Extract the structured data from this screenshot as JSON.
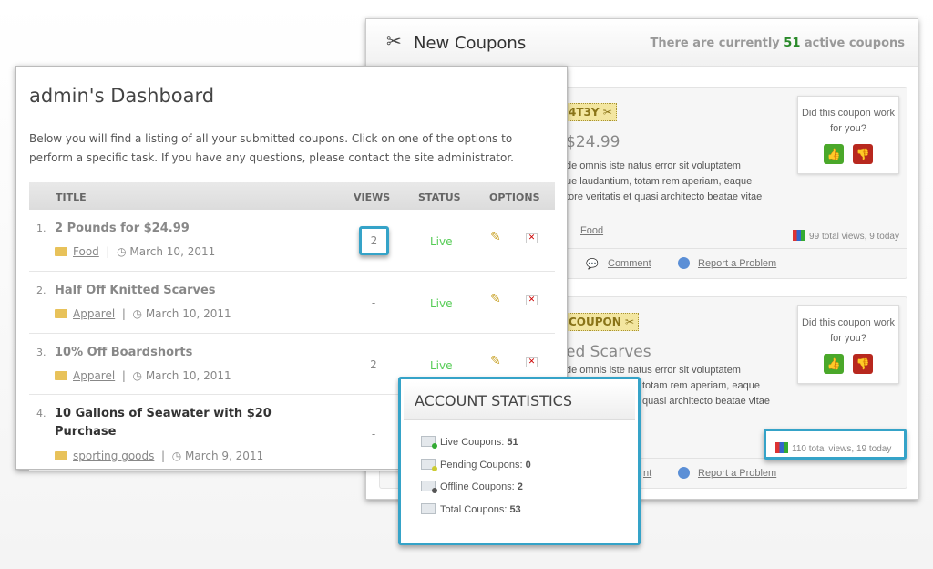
{
  "new_coupons": {
    "title": "New Coupons",
    "active_prefix": "There are currently ",
    "active_count": "51",
    "active_suffix": " active coupons",
    "cards": [
      {
        "code": "4T3Y",
        "price": "$24.99",
        "desc": [
          "de omnis iste natus error sit voluptatem",
          "ue laudantium, totam rem aperiam, eaque",
          "tore veritatis et quasi architecto beatae vitae"
        ],
        "category": "Food",
        "views": "99 total views, 9 today",
        "comment": "Comment",
        "report": "Report a Problem",
        "vote_q": "Did this coupon work for you?"
      },
      {
        "code": "COUPON",
        "price": "ed Scarves",
        "desc": [
          "de omnis iste natus error sit voluptatem",
          "totam rem aperiam, eaque",
          "quasi architecto beatae vitae"
        ],
        "views": "110 total views, 19 today",
        "comment": "nt",
        "report": "Report a Problem",
        "vote_q": "Did this coupon work for you?"
      }
    ]
  },
  "dashboard": {
    "title": "admin's Dashboard",
    "intro": "Below you will find a listing of all your submitted coupons. Click on one of the options to perform a specific task. If you have any questions, please contact the site administrator.",
    "columns": {
      "title": "TITLE",
      "views": "VIEWS",
      "status": "STATUS",
      "options": "OPTIONS"
    },
    "rows": [
      {
        "num": "1.",
        "title": "2 Pounds for $24.99",
        "category": "Food",
        "date": "March 10, 2011",
        "views": "2",
        "status": "Live"
      },
      {
        "num": "2.",
        "title": "Half Off Knitted Scarves",
        "category": "Apparel",
        "date": "March 10, 2011",
        "views": "-",
        "status": "Live"
      },
      {
        "num": "3.",
        "title": "10% Off Boardshorts",
        "category": "Apparel",
        "date": "March 10, 2011",
        "views": "2",
        "status": "Live"
      },
      {
        "num": "4.",
        "title": "10 Gallons of Seawater with $20 Purchase",
        "category": "sporting goods",
        "date": "March 9, 2011",
        "views": "-",
        "status": ""
      }
    ]
  },
  "stats": {
    "title": "ACCOUNT STATISTICS",
    "items": [
      {
        "label": "Live Coupons: ",
        "value": "51",
        "color": "#3a3"
      },
      {
        "label": "Pending Coupons: ",
        "value": "0",
        "color": "#cc3"
      },
      {
        "label": "Offline Coupons: ",
        "value": "2",
        "color": "#555"
      },
      {
        "label": "Total Coupons: ",
        "value": "53",
        "color": ""
      }
    ]
  },
  "colors": {
    "accent": "#35a3c8",
    "active_count": "#2a8a2a",
    "live": "#55cc55"
  }
}
